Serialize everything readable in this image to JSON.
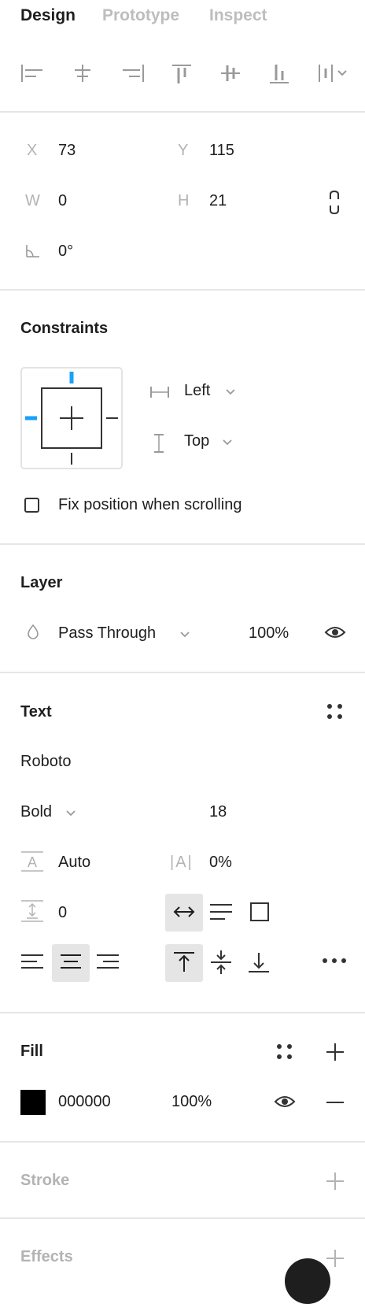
{
  "tabs": [
    {
      "label": "Design"
    },
    {
      "label": "Prototype"
    },
    {
      "label": "Inspect"
    }
  ],
  "transform": {
    "x_label": "X",
    "x_value": "73",
    "y_label": "Y",
    "y_value": "115",
    "w_label": "W",
    "w_value": "0",
    "h_label": "H",
    "h_value": "21",
    "rotation_value": "0°"
  },
  "constraints": {
    "title": "Constraints",
    "horizontal": "Left",
    "vertical": "Top",
    "fix_position_label": "Fix position when scrolling",
    "fix_position_checked": false
  },
  "layer": {
    "title": "Layer",
    "blend_mode": "Pass Through",
    "opacity": "100%"
  },
  "text": {
    "title": "Text",
    "font_family": "Roboto",
    "font_weight": "Bold",
    "font_size": "18",
    "line_height": "Auto",
    "letter_spacing": "0%",
    "paragraph_spacing": "0",
    "letter_spacing_icon_text": "|A|"
  },
  "fill": {
    "title": "Fill",
    "hex": "000000",
    "opacity": "100%",
    "swatch_color": "#000000"
  },
  "stroke": {
    "title": "Stroke"
  },
  "effects": {
    "title": "Effects"
  },
  "colors": {
    "accent_blue": "#18a0fb",
    "muted": "#b3b3b3",
    "divider": "#e6e6e6",
    "active_bg": "#e5e5e5"
  }
}
